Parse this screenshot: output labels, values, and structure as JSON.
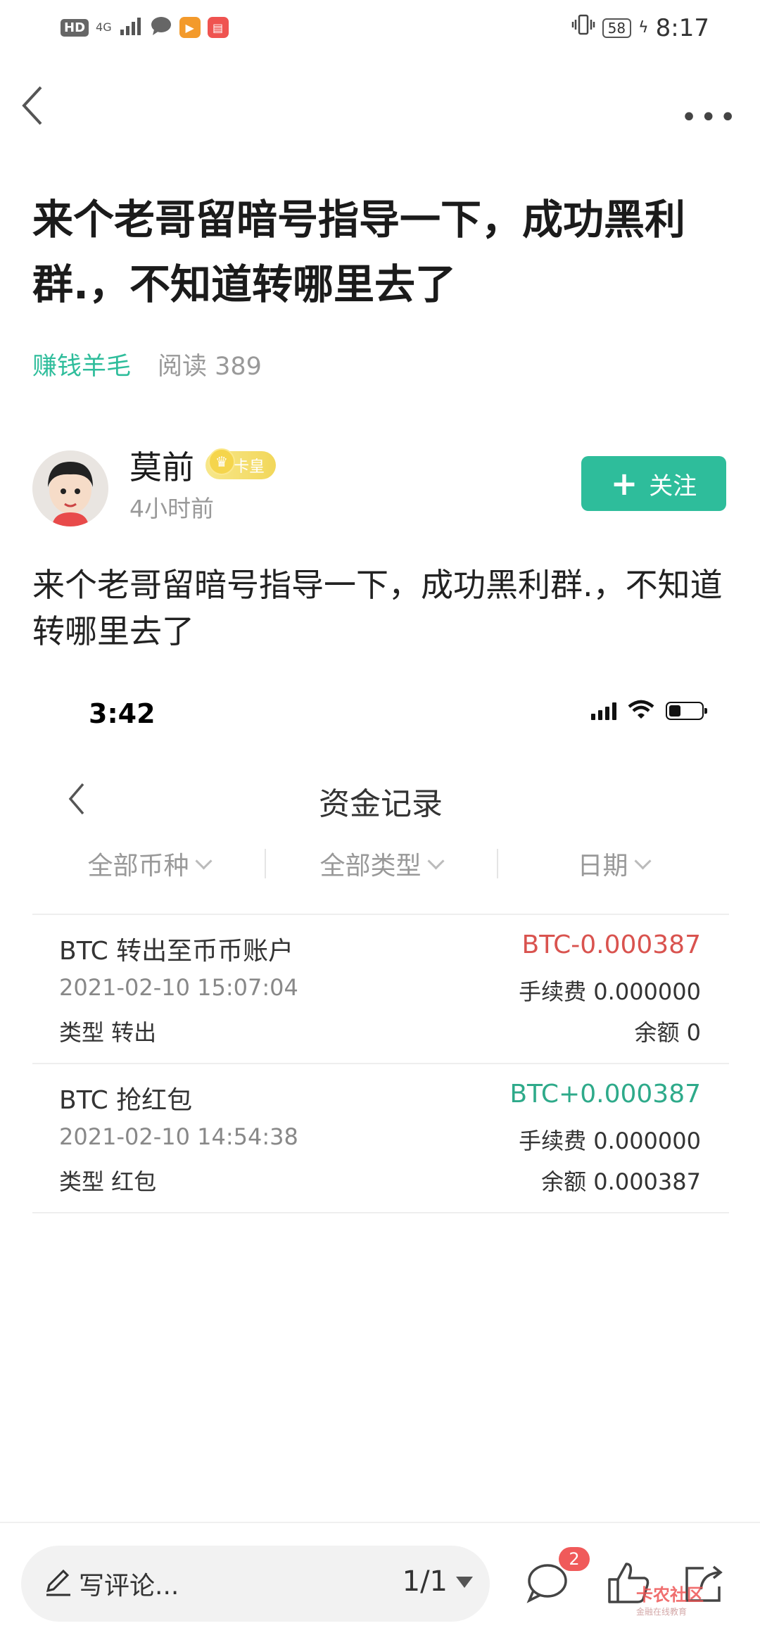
{
  "status_bar": {
    "hd": "HD",
    "network": "4G",
    "battery": "58",
    "time": "8:17"
  },
  "post": {
    "title": "来个老哥留暗号指导一下，成功黑利群.，不知道转哪里去了",
    "tag": "赚钱羊毛",
    "reads": "阅读 389",
    "author": {
      "name": "莫前",
      "badge": "卡皇",
      "time": "4小时前"
    },
    "follow_label": "关注",
    "body": "来个老哥留暗号指导一下，成功黑利群.，不知道转哪里去了"
  },
  "screenshot": {
    "time": "3:42",
    "title": "资金记录",
    "filters": [
      "全部币种",
      "全部类型",
      "日期"
    ],
    "records": [
      {
        "name": "BTC 转出至币币账户",
        "date": "2021-02-10 15:07:04",
        "type": "类型 转出",
        "amount": "BTC-0.000387",
        "fee": "手续费 0.000000",
        "balance": "余额 0"
      },
      {
        "name": "BTC 抢红包",
        "date": "2021-02-10 14:54:38",
        "type": "类型 红包",
        "amount": "BTC+0.000387",
        "fee": "手续费 0.000000",
        "balance": "余额 0.000387"
      }
    ]
  },
  "bottom_bar": {
    "comment_placeholder": "写评论...",
    "page": "1/1",
    "comment_count": "2",
    "watermark": "卡农社区",
    "watermark_sub": "金融在线教育"
  },
  "colors": {
    "accent": "#2ebd9b",
    "negative": "#d9534f",
    "positive": "#2eaa8a"
  }
}
